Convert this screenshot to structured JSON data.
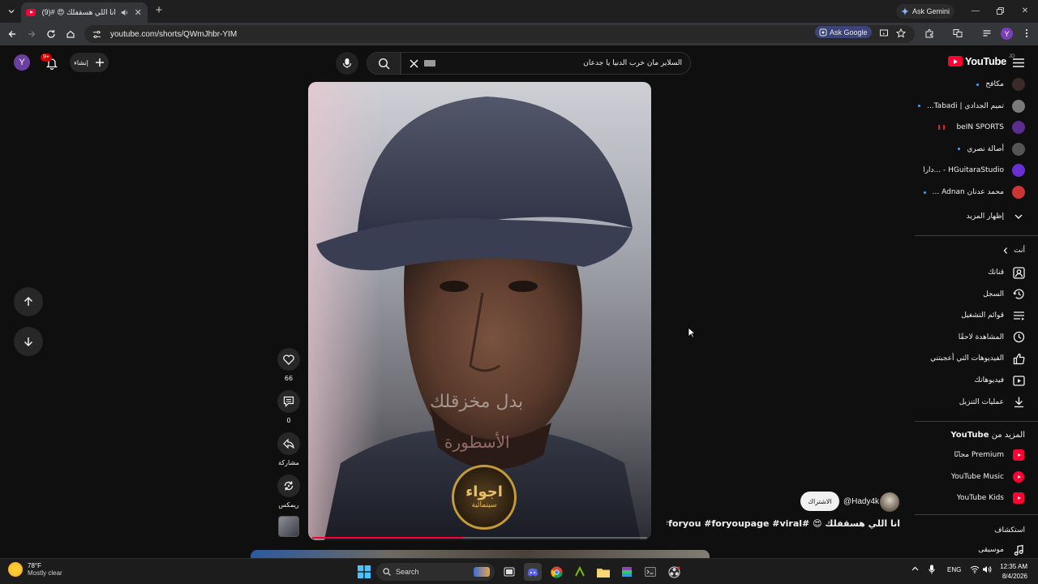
{
  "browser": {
    "tab": {
      "title": "انا اللي هسقفلك 😍 #(9)"
    },
    "ask_gemini": "Ask Gemini",
    "url": "youtube.com/shorts/QWmJhbr-YIM",
    "ask_google": "Ask Google",
    "profile_initial": "Y"
  },
  "yt_header": {
    "avatar_initial": "Y",
    "notifications_badge": "9+",
    "create_label": "إنشاء",
    "search_query": "السلاير مان خرب الدنيا يا جدعان",
    "logo_text": "YouTube",
    "logo_country": "JO"
  },
  "video": {
    "caption_line1": "بدل مخزقلك",
    "caption_line2": "الأسطورة",
    "brand_line1": "اجواء",
    "brand_line2": "سينمائية",
    "progress_fraction": 0.45
  },
  "actions": {
    "like_count": "66",
    "comment_count": "0",
    "share_label": "مشاركة",
    "remix_label": "ريمكس"
  },
  "short_info": {
    "channel_handle": "@Hady4k",
    "subscribe_label": "الاشتراك",
    "title": "انا اللي هسقفلك 😍 #fyp #foryou #foryoupage #viral..."
  },
  "sidebar": {
    "subscriptions": [
      {
        "label": "مكافح",
        "new": true,
        "color": "#3a2a2a"
      },
      {
        "label": "تميم الجدادي | Tabadi...",
        "new": true,
        "color": "#7a7a7a"
      },
      {
        "label": "beIN SPORTS",
        "new": false,
        "live": true,
        "color": "#5b2d8e"
      },
      {
        "label": "أصالة نصري",
        "new": true,
        "color": "#555555"
      },
      {
        "label": "HGuitaraStudio - ...دارا",
        "new": false,
        "color": "#6a2fd0"
      },
      {
        "label": "محمد عدنان Adnan ...",
        "new": true,
        "color": "#cc3333"
      }
    ],
    "show_more": "إظهار المزيد",
    "you_section": "أنت",
    "you_items": [
      {
        "label": "قناتك",
        "icon": "user-icon"
      },
      {
        "label": "السجل",
        "icon": "history-icon"
      },
      {
        "label": "قوائم التشغيل",
        "icon": "playlist-icon"
      },
      {
        "label": "المشاهدة لاحقًا",
        "icon": "clock-icon"
      },
      {
        "label": "الفيديوهات التي أعجبتني",
        "icon": "thumb-up-icon"
      },
      {
        "label": "فيديوهاتك",
        "icon": "your-videos-icon"
      },
      {
        "label": "عمليات التنزيل",
        "icon": "download-icon"
      }
    ],
    "more_from_prefix": "المزيد من",
    "more_from_brand": "YouTube",
    "more_items": [
      {
        "label": "Premium مجانًا",
        "color": "#ff0033"
      },
      {
        "label": "YouTube Music",
        "color": "#ff0033"
      },
      {
        "label": "YouTube Kids",
        "color": "#ff0033"
      }
    ],
    "explore_heading": "استكشاف",
    "explore_items": [
      {
        "label": "موسيقى",
        "icon": "music-icon"
      }
    ]
  },
  "taskbar": {
    "temperature": "78°F",
    "weather_text": "Mostly clear",
    "search_label": "Search",
    "language": "ENG",
    "time": "12:35 AM",
    "date": "8/4/2026"
  },
  "colors": {
    "accent": "#ff0033",
    "background": "#0f0f0f",
    "sidebar_text": "#f1f1f1",
    "new_dot": "#3ea6ff"
  }
}
